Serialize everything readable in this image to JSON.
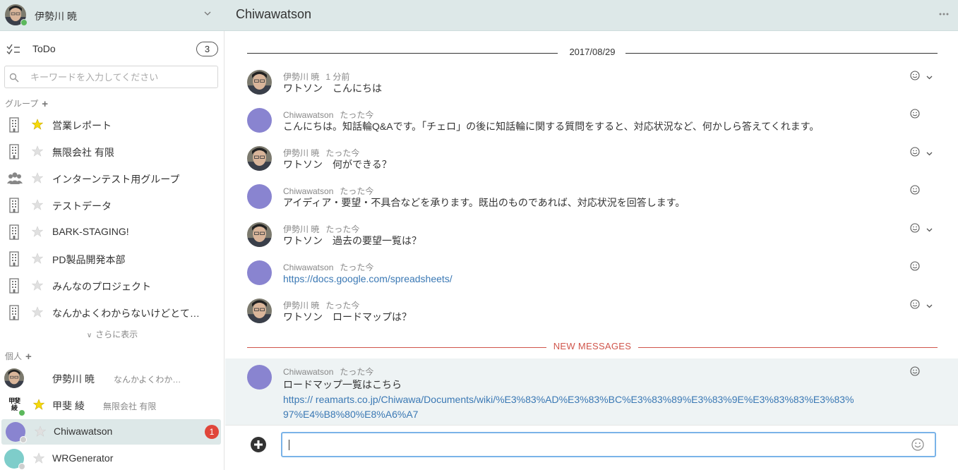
{
  "header": {
    "user_name": "伊勢川 暁",
    "room_title": "Chiwawatson"
  },
  "sidebar": {
    "todo": {
      "label": "ToDo",
      "count": "3"
    },
    "search": {
      "placeholder": "キーワードを入力してください"
    },
    "groups_title": "グループ",
    "groups": [
      {
        "label": "営業レポート",
        "kind": "building-icon",
        "starred": true
      },
      {
        "label": "無限会社 有限",
        "kind": "building-icon",
        "starred": false
      },
      {
        "label": "インターンテスト用グループ",
        "kind": "people-icon",
        "starred": false
      },
      {
        "label": "テストデータ",
        "kind": "building-icon",
        "starred": false
      },
      {
        "label": "BARK-STAGING!",
        "kind": "building-icon",
        "starred": false
      },
      {
        "label": "PD製品開発本部",
        "kind": "building-icon",
        "starred": false
      },
      {
        "label": "みんなのプロジェクト",
        "kind": "building-icon",
        "starred": false
      },
      {
        "label": "なんかよくわからないけどとて…",
        "kind": "building-icon",
        "starred": false
      }
    ],
    "show_more": "さらに表示",
    "personal_title": "個人",
    "dms": [
      {
        "name": "伊勢川 暁",
        "sub": "なんかよくわか…",
        "avatar": "photo",
        "starred": null,
        "status_color": null,
        "unread": ""
      },
      {
        "name": "甲斐 綾",
        "sub": "無限会社 有限",
        "avatar": "kanji",
        "avatar_text": "甲斐綾",
        "starred": true,
        "status_color": "#5cb85c",
        "unread": ""
      },
      {
        "name": "Chiwawatson",
        "sub": "",
        "avatar": "purple",
        "starred": false,
        "status_color": "#cfcfcf",
        "unread": "1"
      },
      {
        "name": "WRGenerator",
        "sub": "",
        "avatar": "teal",
        "starred": false,
        "status_color": "#cfcfcf",
        "unread": ""
      }
    ]
  },
  "chat": {
    "date_divider": "2017/08/29",
    "new_messages_label": "NEW MESSAGES",
    "messages": [
      {
        "author": "伊勢川 暁",
        "time": "1 分前",
        "lines": [
          "ワトソン　こんにちは"
        ],
        "bot": false
      },
      {
        "author": "Chiwawatson",
        "time": "たった今",
        "lines": [
          "こんにちは。知話輪Q&Aです。「チェロ」の後に知話輪に関する質問をすると、対応状況など、何かしら答えてくれます。"
        ],
        "bot": true
      },
      {
        "author": "伊勢川 暁",
        "time": "たった今",
        "lines": [
          "ワトソン　何ができる？"
        ],
        "bot": false
      },
      {
        "author": "Chiwawatson",
        "time": "たった今",
        "lines": [
          "アイディア・要望・不具合などを承ります。既出のものであれば、対応状況を回答します。"
        ],
        "bot": true
      },
      {
        "author": "伊勢川 暁",
        "time": "たった今",
        "lines": [
          "ワトソン　過去の要望一覧は？"
        ],
        "bot": false
      },
      {
        "author": "Chiwawatson",
        "time": "たった今",
        "lines": [],
        "link": "https://docs.google.com/spreadsheets/",
        "bot": true
      },
      {
        "author": "伊勢川 暁",
        "time": "たった今",
        "lines": [
          "ワトソン　ロードマップは？"
        ],
        "bot": false
      }
    ],
    "new_message": {
      "author": "Chiwawatson",
      "time": "たった今",
      "text": "ロードマップ一覧はこちら",
      "link_line1": "https://                reamarts.co.jp/Chiwawa/Documents/wiki/%E3%83%AD%E3%83%BC%E3%83%89%E3%83%9E%E3%83%83%E3%83%",
      "link_line2": "97%E4%B8%80%E8%A6%A7"
    }
  },
  "colors": {
    "topbar_bg": "#dde8e8",
    "active_row_bg": "#dde8e8",
    "bot_avatar": "#8984d0",
    "teal_avatar": "#7ecdca",
    "link": "#3a78b4",
    "new_messages_red": "#d0554b",
    "unread_badge": "#e0463a",
    "online_green": "#5cb85c",
    "star_yellow": "#f5d90a",
    "input_focus_border": "#7ab3e8"
  }
}
